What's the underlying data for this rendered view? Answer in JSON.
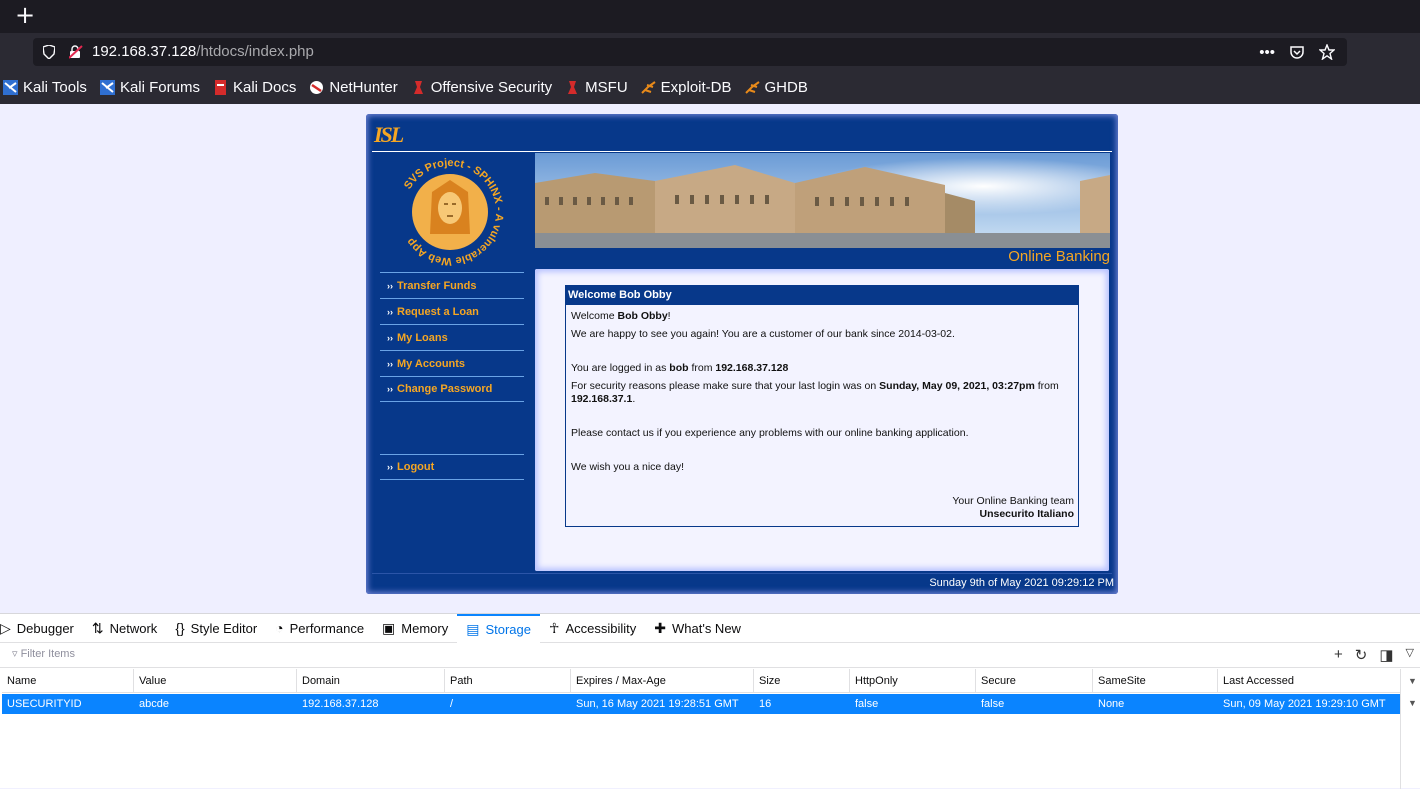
{
  "browser": {
    "new_tab": "+",
    "url_host": "192.168.37.128",
    "url_path": "/htdocs/index.php",
    "page_actions": [
      "•••",
      "pocket",
      "star"
    ],
    "bookmarks": [
      {
        "label": "Kali Tools",
        "icon": "kali-icon"
      },
      {
        "label": "Kali Forums",
        "icon": "kali-icon"
      },
      {
        "label": "Kali Docs",
        "icon": "kali-docs-icon"
      },
      {
        "label": "NetHunter",
        "icon": "nethunter-icon"
      },
      {
        "label": "Offensive Security",
        "icon": "offsec-icon"
      },
      {
        "label": "MSFU",
        "icon": "msfu-icon"
      },
      {
        "label": "Exploit-DB",
        "icon": "exploitdb-icon"
      },
      {
        "label": "GHDB",
        "icon": "exploitdb-icon"
      }
    ]
  },
  "site": {
    "logo": "ISL",
    "sphinx_text": "SVS Project - SPHINX - A vulnerable Web App",
    "online_banking": "Online Banking",
    "menu": [
      "Transfer Funds",
      "Request a Loan",
      "My Loans",
      "My Accounts",
      "Change Password"
    ],
    "logout": "Logout",
    "menu_arrow": "››",
    "welcome_title": "Welcome Bob Obby",
    "greet_prefix": "Welcome ",
    "greet_name": "Bob Obby",
    "greet_suffix": "!",
    "customer_line": "We are happy to see you again! You are a customer of our bank since 2014-03-02.",
    "logged_prefix": "You are logged in as ",
    "logged_user": "bob",
    "logged_mid": " from ",
    "logged_ip": "192.168.37.128",
    "security_prefix": "For security reasons please make sure that your last login was on ",
    "security_date": "Sunday, May 09, 2021, 03:27pm",
    "security_mid": " from ",
    "security_ip": "192.168.37.1",
    "security_suffix": ".",
    "contact_line": "Please contact us if you experience any problems with our online banking application.",
    "nice_day": "We wish you a nice day!",
    "team_line": "Your Online Banking team",
    "team_name": "Unsecurito Italiano",
    "footer_date": "Sunday 9th of May 2021 09:29:12 PM"
  },
  "devtools": {
    "tabs": [
      {
        "label": "Debugger",
        "icon": "debugger-icon",
        "glyph": "▷"
      },
      {
        "label": "Network",
        "icon": "network-icon",
        "glyph": "⇅"
      },
      {
        "label": "Style Editor",
        "icon": "style-editor-icon",
        "glyph": "{}"
      },
      {
        "label": "Performance",
        "icon": "performance-icon",
        "glyph": "◔"
      },
      {
        "label": "Memory",
        "icon": "memory-icon",
        "glyph": "▣"
      },
      {
        "label": "Storage",
        "icon": "storage-icon",
        "glyph": "▤"
      },
      {
        "label": "Accessibility",
        "icon": "accessibility-icon",
        "glyph": "☥"
      },
      {
        "label": "What's New",
        "icon": "whats-new-icon",
        "glyph": "✚"
      }
    ],
    "selected_tab": "Storage",
    "filter_placeholder": "Filter Items",
    "columns": [
      "Name",
      "Value",
      "Domain",
      "Path",
      "Expires / Max-Age",
      "Size",
      "HttpOnly",
      "Secure",
      "SameSite",
      "Last Accessed"
    ],
    "rows": [
      [
        "USECURITYID",
        "abcde",
        "192.168.37.128",
        "/",
        "Sun, 16 May 2021 19:28:51 GMT",
        "16",
        "false",
        "false",
        "None",
        "Sun, 09 May 2021 19:29:10 GMT"
      ]
    ],
    "accent": "#0a84ff"
  }
}
